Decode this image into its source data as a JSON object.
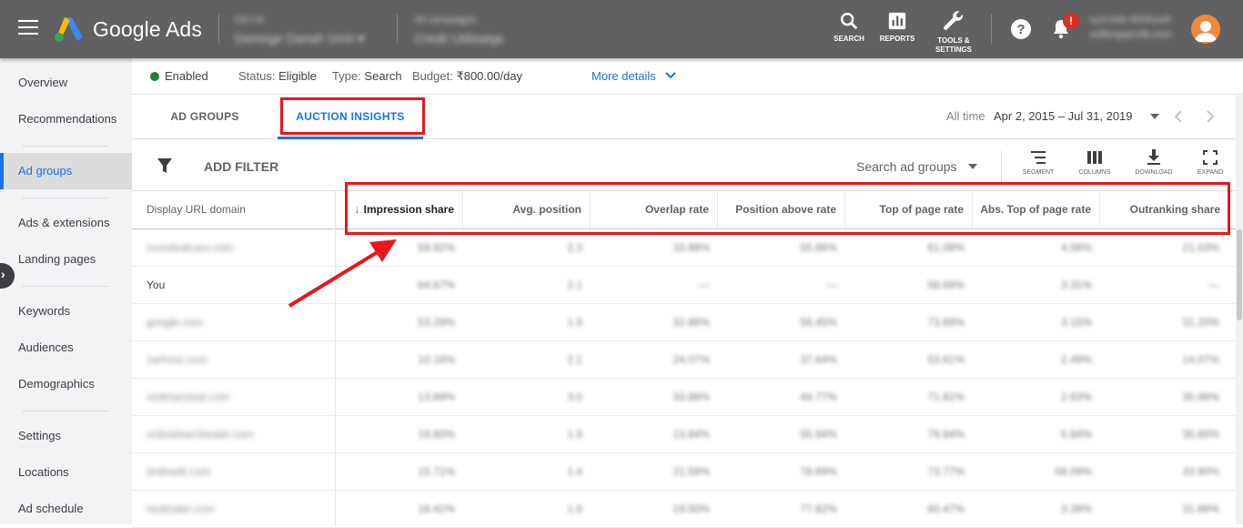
{
  "topbar": {
    "app_name": "Google Ads",
    "account_blur_1": "Cli·l·nt",
    "account_blur_2": "Demoge Danah Umh ▾",
    "account_blur_3": "All campaigns",
    "account_blur_4": "Credit Utilisatge",
    "search_label": "SEARCH",
    "reports_label": "REPORTS",
    "tools_label_1": "TOOLS &",
    "tools_label_2": "SETTINGS",
    "notification_badge": "!",
    "user_blur_1": "ryzt-Ads-500fuxell",
    "user_blur_2": "salibogaprotb.com"
  },
  "sidebar": {
    "items": [
      {
        "label": "Overview"
      },
      {
        "label": "Recommendations"
      },
      {
        "label": "Ad groups"
      },
      {
        "label": "Ads & extensions"
      },
      {
        "label": "Landing pages"
      },
      {
        "label": "Keywords"
      },
      {
        "label": "Audiences"
      },
      {
        "label": "Demographics"
      },
      {
        "label": "Settings"
      },
      {
        "label": "Locations"
      },
      {
        "label": "Ad schedule"
      }
    ],
    "collapse_glyph": "›"
  },
  "status": {
    "enabled": "Enabled",
    "status_label": "Status:",
    "status_value": "Eligible",
    "type_label": "Type:",
    "type_value": "Search",
    "budget_label": "Budget:",
    "budget_value": "₹800.00/day",
    "more_details": "More details"
  },
  "tabs": [
    {
      "label": "AD GROUPS"
    },
    {
      "label": "AUCTION INSIGHTS"
    }
  ],
  "date": {
    "label": "All time",
    "range": "Apr 2, 2015 – Jul 31, 2019"
  },
  "toolbar": {
    "add_filter": "ADD FILTER",
    "search_placeholder": "Search ad groups",
    "segment": "SEGMENT",
    "columns": "COLUMNS",
    "download": "DOWNLOAD",
    "expand": "EXPAND"
  },
  "table": {
    "headers": [
      "Display URL domain",
      "Impression share",
      "Avg. position",
      "Overlap rate",
      "Position above rate",
      "Top of page rate",
      "Abs. Top of page rate",
      "Outranking share"
    ],
    "sort_glyph": "↓",
    "rows": [
      {
        "domain": "vuredealcare.com",
        "cells": [
          "59.82%",
          "2.3",
          "33.88%",
          "55.86%",
          "61.08%",
          "4.56%",
          "21.03%"
        ]
      },
      {
        "domain": "You",
        "cells": [
          "64.67%",
          "2.1",
          "—",
          "—",
          "58.69%",
          "3.31%",
          "—"
        ]
      },
      {
        "domain": "google.com",
        "cells": [
          "53.29%",
          "1.9",
          "32.86%",
          "56.45%",
          "73.69%",
          "3.15%",
          "31.20%"
        ]
      },
      {
        "domain": "carhore.com",
        "cells": [
          "10.16%",
          "2.1",
          "24.07%",
          "37.64%",
          "53.61%",
          "2.49%",
          "14.07%"
        ]
      },
      {
        "domain": "vedmanoeal.com",
        "cells": [
          "13.69%",
          "3.0",
          "33.88%",
          "44.77%",
          "71.81%",
          "2.63%",
          "35.96%"
        ]
      },
      {
        "domain": "onlinelearnhealer.com",
        "cells": [
          "19.60%",
          "1.9",
          "13.84%",
          "55.94%",
          "79.84%",
          "5.84%",
          "35.60%"
        ]
      },
      {
        "domain": "drdinwik.com",
        "cells": [
          "15.71%",
          "1.4",
          "21.59%",
          "78.69%",
          "73.77%",
          "58.09%",
          "33.90%"
        ]
      },
      {
        "domain": "healnaler.com",
        "cells": [
          "16.41%",
          "1.6",
          "19.50%",
          "77.82%",
          "60.47%",
          "3.39%",
          "31.86%"
        ]
      }
    ]
  }
}
